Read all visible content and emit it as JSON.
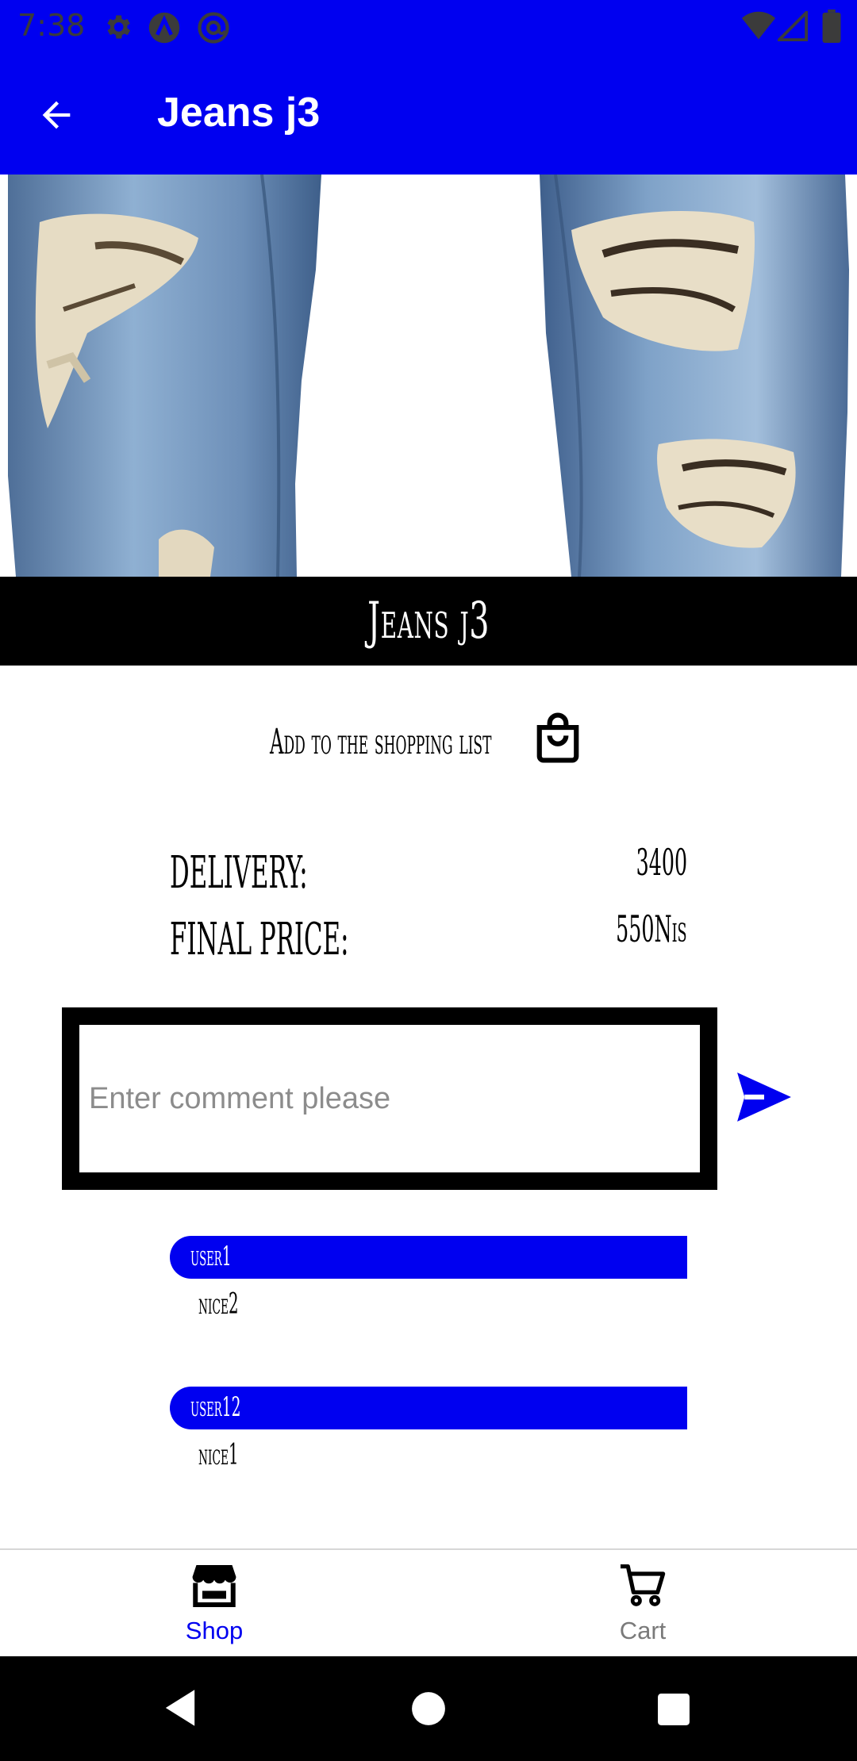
{
  "status_bar": {
    "time": "7:38",
    "icons": [
      "settings-icon",
      "a-badge-icon",
      "at-sign-icon",
      "wifi-icon",
      "signal-icon",
      "battery-icon"
    ]
  },
  "app_bar": {
    "title": "Jeans j3",
    "back_icon": "arrow-left-icon"
  },
  "product": {
    "image_alt": "product-image",
    "name": "Jeans j3",
    "add_to_list_label": "Add to the shopping list",
    "add_to_list_icon": "shopping-bag-icon",
    "delivery_label": "DELIVERY:",
    "delivery_value": "3400",
    "final_price_label": "FINAL PRICE:",
    "final_price_value": "550Nis"
  },
  "comment": {
    "placeholder": "Enter comment please",
    "value": "",
    "send_icon": "send-icon"
  },
  "comments": [
    {
      "user": "user1",
      "text": "nice2"
    },
    {
      "user": "user12",
      "text": "nice1"
    }
  ],
  "bottom_nav": {
    "items": [
      {
        "label": "Shop",
        "icon": "store-icon",
        "active": true
      },
      {
        "label": "Cart",
        "icon": "cart-icon",
        "active": false
      }
    ]
  },
  "colors": {
    "primary": "#0000f0",
    "active_nav": "#0000f0",
    "inactive_nav": "#7a7a7a",
    "name_band": "#000000"
  }
}
